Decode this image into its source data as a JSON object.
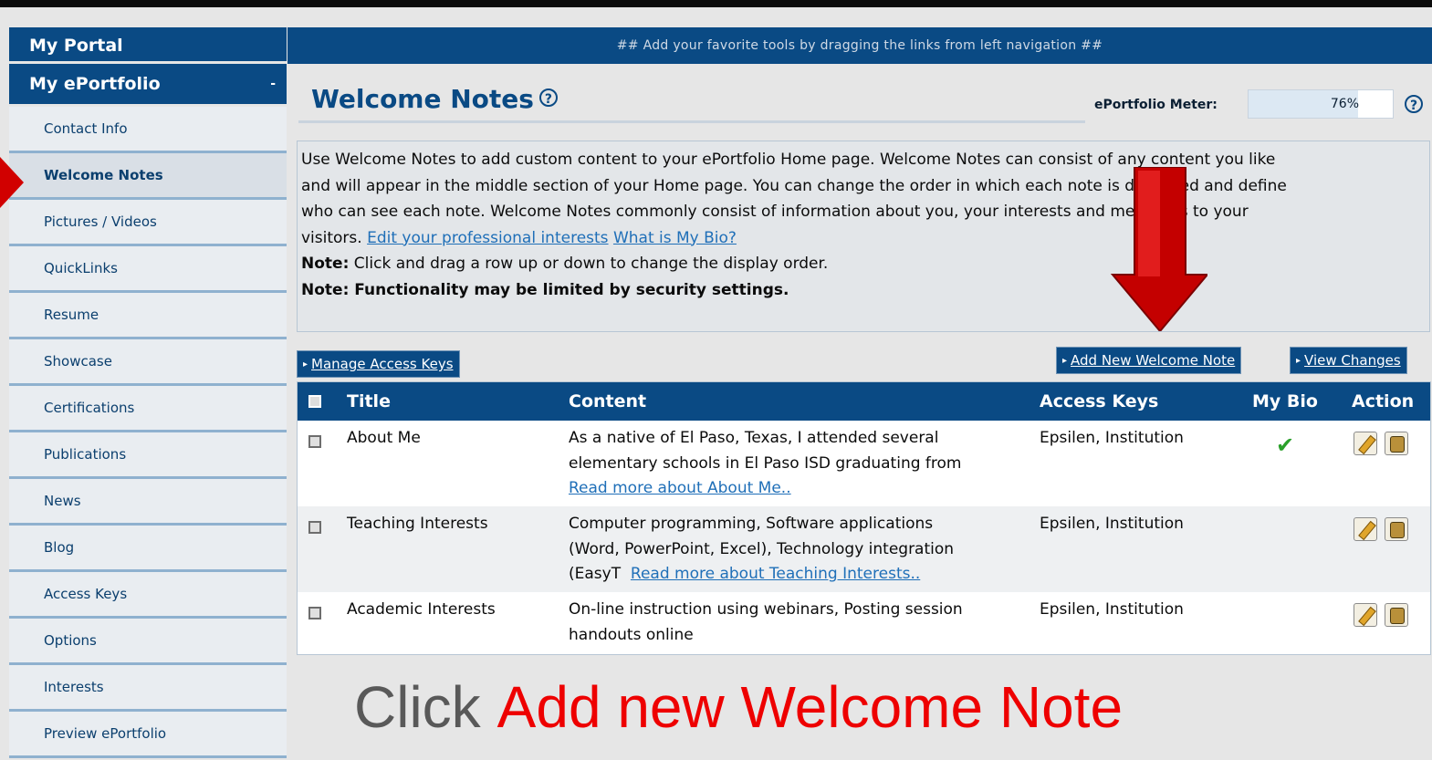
{
  "sidebar": {
    "portal": "My Portal",
    "eportfolio": "My ePortfolio",
    "eportfolio_marker": "-",
    "items": [
      {
        "label": "Contact Info"
      },
      {
        "label": "Welcome Notes"
      },
      {
        "label": "Pictures / Videos"
      },
      {
        "label": "QuickLinks"
      },
      {
        "label": "Resume"
      },
      {
        "label": "Showcase"
      },
      {
        "label": "Certifications"
      },
      {
        "label": "Publications"
      },
      {
        "label": "News"
      },
      {
        "label": "Blog"
      },
      {
        "label": "Access Keys"
      },
      {
        "label": "Options"
      },
      {
        "label": "Interests"
      },
      {
        "label": "Preview ePortfolio"
      }
    ]
  },
  "tip_bar": "## Add your favorite tools by dragging the links from left navigation ##",
  "page_title": "Welcome Notes",
  "help_glyph": "?",
  "meter": {
    "label": "ePortfolio Meter:",
    "value_text": "76%",
    "value": 0.76
  },
  "info": {
    "line1": "Use Welcome Notes to add custom content to your ePortfolio Home page. Welcome Notes can consist of any content you like",
    "line2": "and will appear in the middle section of your Home page. You can change the order in which each note is displayed and define",
    "line3": "who can see each note. Welcome Notes commonly consist of information about you, your interests and messages to your",
    "line4_prefix": "visitors.",
    "link1": "Edit your professional interests",
    "link2": "What is My Bio?",
    "note1_label": "Note:",
    "note1_text": "Click and drag a row up or down to change the display order.",
    "note2": "Note: Functionality may be limited by security settings."
  },
  "buttons": {
    "manage": "Manage Access Keys",
    "add": "Add New Welcome Note",
    "view": "View Changes",
    "arrow": "▸"
  },
  "table": {
    "headers": {
      "title": "Title",
      "content": "Content",
      "access": "Access Keys",
      "bio": "My Bio",
      "action": "Action"
    },
    "rows": [
      {
        "title": "About Me",
        "content_l1": "As a native of El Paso, Texas, I attended several",
        "content_l2": "elementary schools in El Paso ISD graduating from",
        "read_more": "Read more about About Me..",
        "access": "Epsilen, Institution",
        "bio_check": "✔"
      },
      {
        "title": "Teaching Interests",
        "content_l1": "Computer programming, Software applications",
        "content_l2": "(Word, PowerPoint, Excel), Technology integration",
        "content_l3": "(EasyT",
        "read_more": "Read more about Teaching Interests..",
        "access": "Epsilen, Institution"
      },
      {
        "title": "Academic Interests",
        "content_l1": "On-line instruction using webinars, Posting session",
        "content_l2": "handouts online",
        "access": "Epsilen, Institution"
      }
    ]
  },
  "caption": {
    "part1": "Click",
    "part2": "Add new Welcome Note"
  },
  "colors": {
    "navy": "#0a4a84",
    "annotation_red": "#ee0000",
    "link": "#1f6fb8"
  }
}
